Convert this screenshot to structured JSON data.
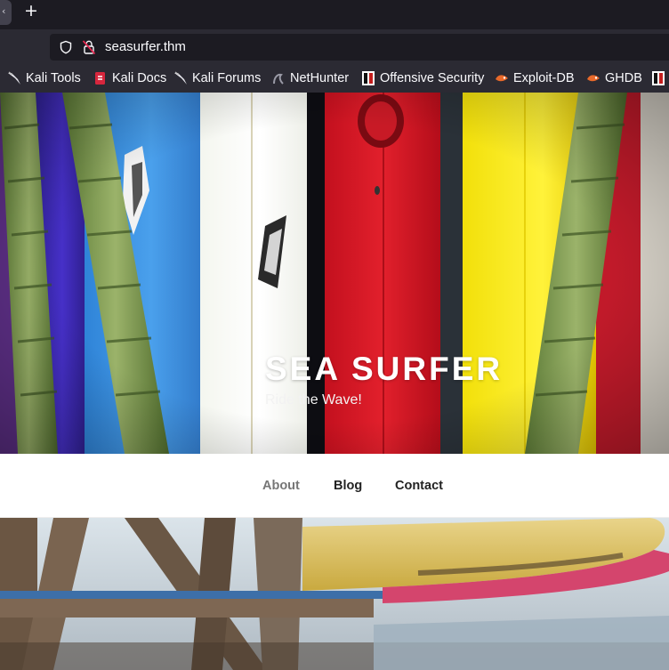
{
  "browser": {
    "new_tab_glyph": "+",
    "url": "seasurfer.thm",
    "bookmarks": [
      {
        "label": "Kali Tools",
        "icon": "kali-dragon-icon"
      },
      {
        "label": "Kali Docs",
        "icon": "kali-docs-icon"
      },
      {
        "label": "Kali Forums",
        "icon": "kali-dragon-icon"
      },
      {
        "label": "NetHunter",
        "icon": "nethunter-icon"
      },
      {
        "label": "Offensive Security",
        "icon": "offsec-icon"
      },
      {
        "label": "Exploit-DB",
        "icon": "exploit-db-icon"
      },
      {
        "label": "GHDB",
        "icon": "exploit-db-icon"
      }
    ]
  },
  "site": {
    "title": "SEA SURFER",
    "tagline": "Ride the Wave!",
    "nav": [
      {
        "label": "About",
        "active": true
      },
      {
        "label": "Blog",
        "active": false
      },
      {
        "label": "Contact",
        "active": false
      }
    ]
  },
  "colors": {
    "chrome_dark": "#1c1b22",
    "chrome_toolbar": "#2b2a33",
    "nav_active": "#767676",
    "nav_text": "#222222"
  }
}
